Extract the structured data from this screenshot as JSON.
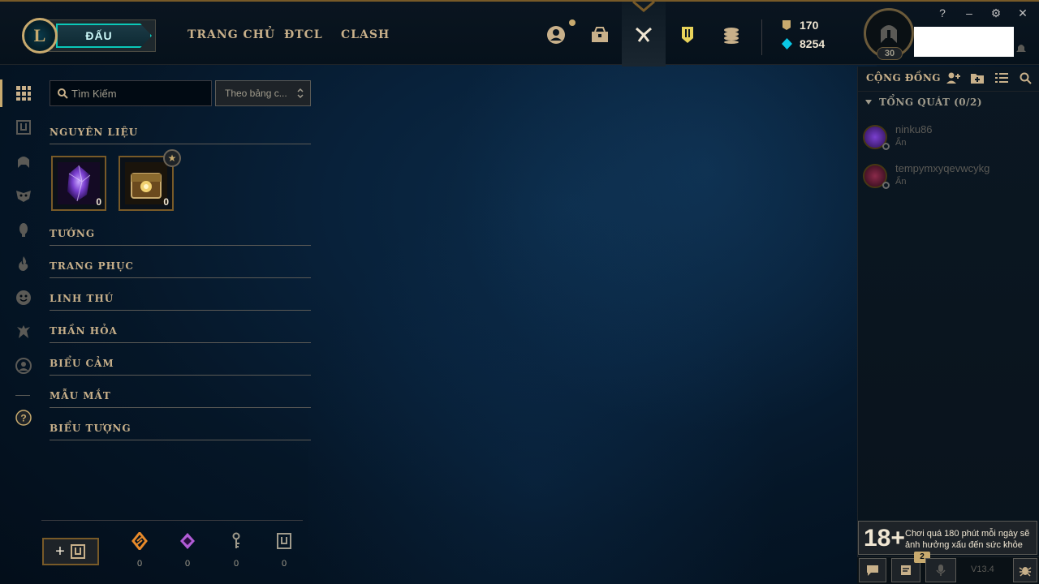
{
  "topbar": {
    "logo_text": "L",
    "play_label": "ĐẤU",
    "nav": [
      "TRANG CHỦ",
      "ĐTCL",
      "CLASH"
    ],
    "icons": [
      "profile-icon",
      "collection-icon",
      "loot-icon",
      "tft-icon",
      "store-icon"
    ],
    "currency": {
      "rp": "170",
      "be": "8254"
    },
    "level": "30",
    "window_controls": [
      "?",
      "–",
      "⚙",
      "✕"
    ]
  },
  "leftnav": {
    "icons": [
      "grid-icon",
      "chest-icon",
      "champion-icon",
      "skin-icon",
      "ward-icon",
      "emote-fire-icon",
      "emote-face-icon",
      "tactician-icon",
      "profile-icon",
      "help-icon"
    ]
  },
  "filters": {
    "search_placeholder": "Tìm Kiếm",
    "sort_label": "Theo bảng c..."
  },
  "sections": {
    "materials": "NGUYÊN LIỆU",
    "champions": "TƯỚNG",
    "skins": "TRANG PHỤC",
    "companions": "LINH THÚ",
    "ward": "THẦN HỎA",
    "emotes": "BIỂU CẢM",
    "chromas": "MẪU MẮT",
    "icons": "BIỂU TƯỢNG"
  },
  "items": [
    {
      "name": "gemstone",
      "count": "0"
    },
    {
      "name": "hextech-chest",
      "count": "0"
    }
  ],
  "resources": [
    {
      "icon": "orange-essence-icon",
      "value": "0",
      "color": "#e88a2a"
    },
    {
      "icon": "mythic-essence-icon",
      "value": "0",
      "color": "#b15cd6"
    },
    {
      "icon": "key-fragment-icon",
      "value": "0",
      "color": "#a09b8c"
    },
    {
      "icon": "chest-resource-icon",
      "value": "0",
      "color": "#a09b8c"
    }
  ],
  "social": {
    "title": "CỘNG ĐỒNG",
    "group": "TỔNG QUÁT (0/2)",
    "friends": [
      {
        "name": "ninku86",
        "status": "Ẩn"
      },
      {
        "name": "tempymxyqevwcykg",
        "status": "Ẩn"
      }
    ],
    "age_rating": "18+",
    "warning": "Chơi quá 180 phút mỗi ngày sẽ ảnh hưởng xấu đến sức khỏe",
    "notif_count": "2",
    "version": "V13.4"
  },
  "colors": {
    "gold": "#c8aa6e",
    "teal": "#0ac8b9",
    "text": "#a09b8c"
  }
}
